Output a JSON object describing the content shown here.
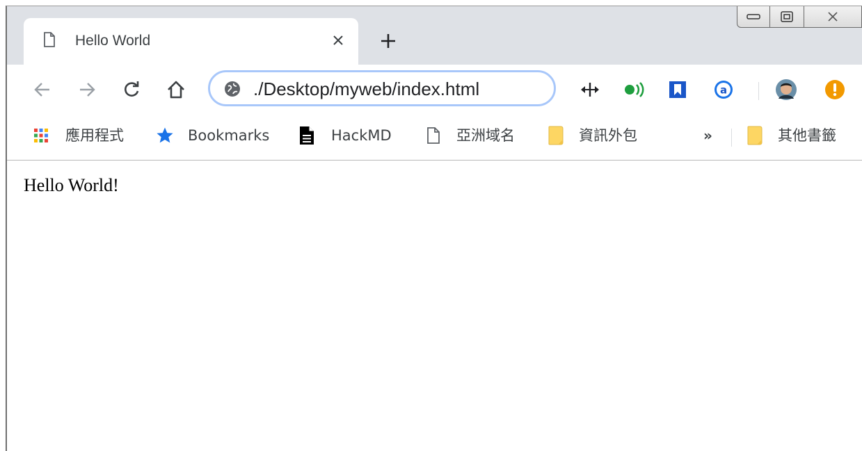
{
  "tab": {
    "title": "Hello World"
  },
  "omnibox": {
    "url": "./Desktop/myweb/index.html"
  },
  "bookmarks": {
    "items": [
      {
        "label": "應用程式",
        "icon": "apps-grid-icon"
      },
      {
        "label": "Bookmarks",
        "icon": "star-icon"
      },
      {
        "label": "HackMD",
        "icon": "document-icon"
      },
      {
        "label": "亞洲域名",
        "icon": "page-icon"
      },
      {
        "label": "資訊外包",
        "icon": "folder-icon"
      }
    ],
    "overflow": "»",
    "other": {
      "label": "其他書籤",
      "icon": "folder-icon"
    }
  },
  "page": {
    "text": "Hello World!"
  },
  "colors": {
    "tabstrip": "#dee1e6",
    "omnibox_focus": "#a8c7fa",
    "star": "#1a73e8",
    "ext_green": "#1e9e3e",
    "ext_blue": "#1a56c8",
    "ext_orange": "#f29900",
    "folder": "#fdd663"
  }
}
